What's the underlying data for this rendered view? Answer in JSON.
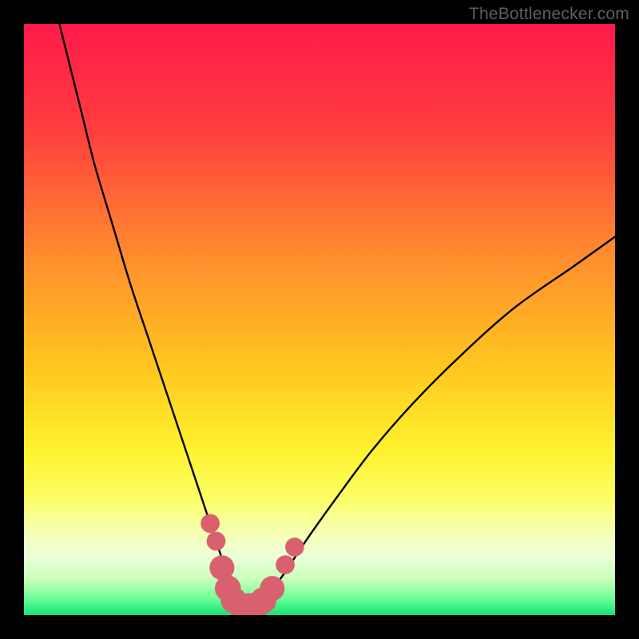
{
  "watermark": "TheBottlenecker.com",
  "chart_data": {
    "type": "line",
    "title": "",
    "xlabel": "",
    "ylabel": "",
    "xlim": [
      0,
      100
    ],
    "ylim": [
      0,
      100
    ],
    "background_gradient_stops": [
      {
        "offset": 0,
        "color": "#ff1a4b"
      },
      {
        "offset": 18,
        "color": "#ff3e3e"
      },
      {
        "offset": 40,
        "color": "#ff8f2e"
      },
      {
        "offset": 58,
        "color": "#ffc61f"
      },
      {
        "offset": 72,
        "color": "#fff22e"
      },
      {
        "offset": 80,
        "color": "#fbff63"
      },
      {
        "offset": 86,
        "color": "#f5ffb3"
      },
      {
        "offset": 90,
        "color": "#ecffd7"
      },
      {
        "offset": 94,
        "color": "#c8ffba"
      },
      {
        "offset": 97,
        "color": "#72ff9a"
      },
      {
        "offset": 100,
        "color": "#14e27a"
      }
    ],
    "series": [
      {
        "name": "bottleneck-curve",
        "x": [
          6,
          8,
          10,
          12,
          15,
          18,
          21,
          24,
          27,
          30,
          32,
          34,
          35.5,
          37,
          39,
          41,
          44,
          48,
          53,
          59,
          66,
          74,
          83,
          93,
          100
        ],
        "y": [
          100,
          92,
          84,
          76,
          66,
          56,
          47,
          38,
          29,
          20,
          14,
          8,
          3,
          1,
          1.5,
          3,
          7,
          13,
          20,
          28,
          36,
          44,
          52,
          59,
          64
        ]
      }
    ],
    "markers": {
      "name": "highlight-cluster",
      "color": "#d9606e",
      "points": [
        {
          "x": 31.5,
          "y": 15.5,
          "r": 1.6
        },
        {
          "x": 32.5,
          "y": 12.5,
          "r": 1.6
        },
        {
          "x": 33.5,
          "y": 8.0,
          "r": 2.1
        },
        {
          "x": 34.5,
          "y": 4.5,
          "r": 2.2
        },
        {
          "x": 35.5,
          "y": 2.5,
          "r": 2.2
        },
        {
          "x": 36.7,
          "y": 1.6,
          "r": 2.2
        },
        {
          "x": 38.0,
          "y": 1.5,
          "r": 2.2
        },
        {
          "x": 39.3,
          "y": 1.6,
          "r": 2.2
        },
        {
          "x": 40.5,
          "y": 2.5,
          "r": 2.2
        },
        {
          "x": 42.0,
          "y": 4.5,
          "r": 2.1
        },
        {
          "x": 44.2,
          "y": 8.5,
          "r": 1.6
        },
        {
          "x": 45.8,
          "y": 11.5,
          "r": 1.6
        }
      ]
    }
  }
}
